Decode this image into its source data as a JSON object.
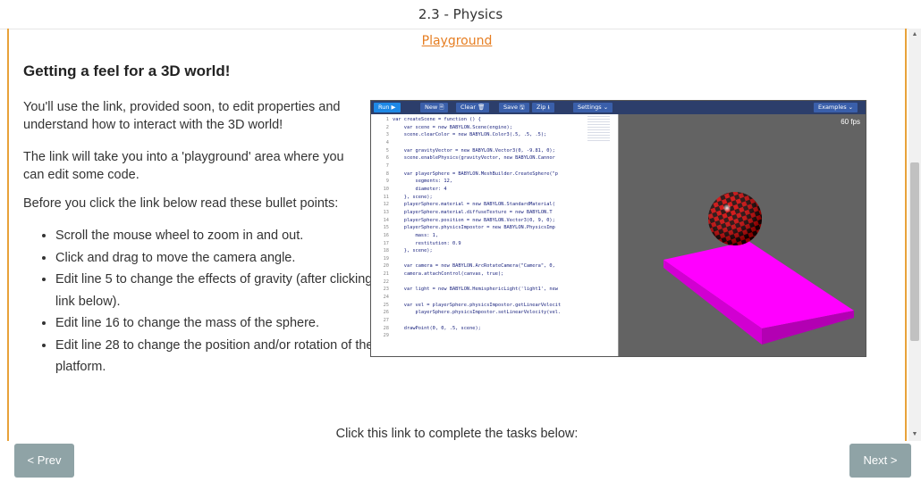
{
  "header": {
    "title": "2.3 - Physics"
  },
  "content": {
    "playground_link": "Playground",
    "heading": "Getting a feel for a 3D world!",
    "paragraphs": [
      "You'll use the link, provided soon, to edit properties and understand how to interact with the 3D world!",
      "The link will take you into a 'playground' area where you can edit some code.",
      "Before you click the link below read these bullet points:"
    ],
    "bullets": [
      "Scroll the mouse wheel to zoom in and out.",
      "Click and drag to move the camera angle.",
      "Edit line 5 to change the effects of gravity (after clicking the link below).",
      "Edit line 16 to change the mass of the sphere.",
      "Edit line 28 to change the position and/or rotation of the platform."
    ],
    "bottom_text": "Click this link to complete the tasks below:"
  },
  "playground": {
    "toolbar": {
      "run": "Run ▶",
      "new": "New 🗎",
      "clear": "Clear 🗑",
      "save": "Save 🖫",
      "zip": "Zip ⭳",
      "settings": "Settings ⌄",
      "examples": "Examples ⌄"
    },
    "fps": "60 fps",
    "line_numbers": "1\n2\n3\n4\n5\n6\n7\n8\n9\n10\n11\n12\n13\n14\n15\n16\n17\n18\n19\n20\n21\n22\n23\n24\n25\n26\n27\n28\n29",
    "code": "var createScene = function () {\n    var scene = new BABYLON.Scene(engine);\n    scene.clearColor = new BABYLON.Color3(.5, .5, .5);\n\n    var gravityVector = new BABYLON.Vector3(0, -9.81, 0);\n    scene.enablePhysics(gravityVector, new BABYLON.Cannor\n\n    var playerSphere = BABYLON.MeshBuilder.CreateSphere(\"p\n        segments: 12,\n        diameter: 4\n    }, scene);\n    playerSphere.material = new BABYLON.StandardMaterial(\n    playerSphere.material.diffuseTexture = new BABYLON.T\n    playerSphere.position = new BABYLON.Vector3(0, 9, 0);\n    playerSphere.physicsImpostor = new BABYLON.PhysicsImp\n        mass: 1,\n        restitution: 0.9\n    }, scene);\n\n    var camera = new BABYLON.ArcRotateCamera(\"Camera\", 0,\n    camera.attachControl(canvas, true);\n\n    var light = new BABYLON.HemisphericLight('light1', new\n\n    var vel = playerSphere.physicsImpostor.getLinearVelocit\n        playerSphere.physicsImpostor.setLinearVelocity(vel.\n\n    drawPoint(0, 0, .5, scene);\n"
  },
  "nav": {
    "prev": "< Prev",
    "next": "Next >"
  },
  "colors": {
    "accent": "#e8a23a",
    "link": "#e67e22",
    "nav_button": "#8fa3a6",
    "platform": "#ff00ff"
  }
}
